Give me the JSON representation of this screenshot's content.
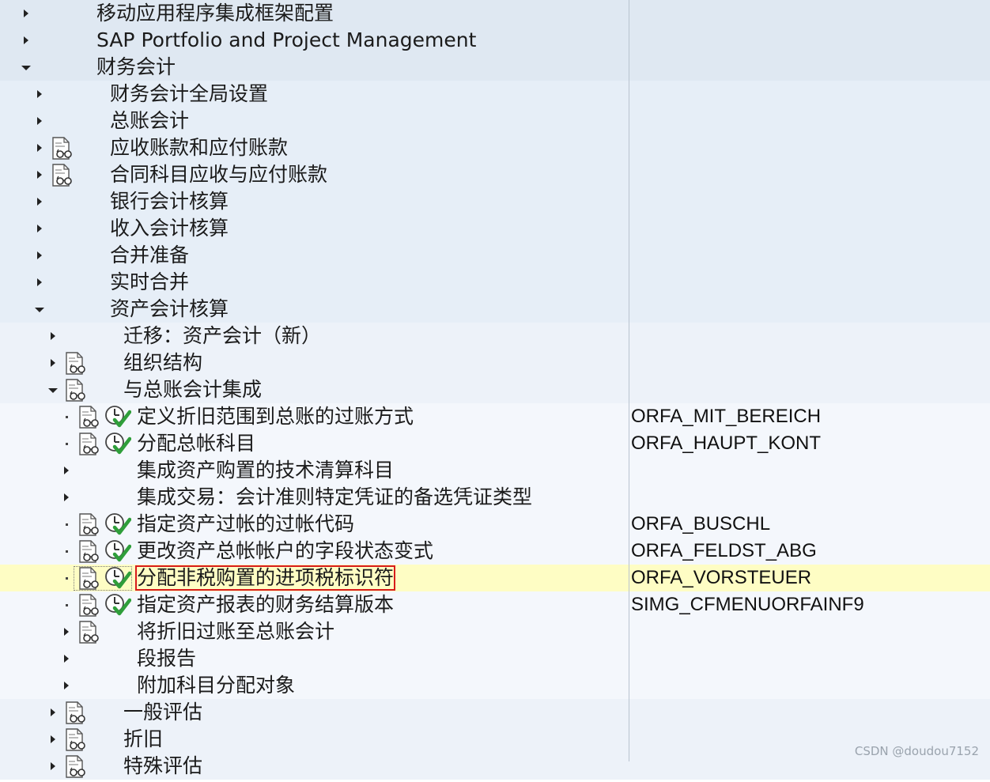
{
  "watermark": "CSDN @doudou7152",
  "colors": {
    "level0_bg": "#dfe8f2",
    "level1_bg": "#e6eef7",
    "level2_bg": "#edf2f9",
    "level3_bg": "#f4f7fc",
    "selected_bg": "#fefdc4",
    "focus_outline": "#d81b1b",
    "check_green": "#2f9e3a"
  },
  "tree": {
    "nodes": [
      {
        "label": "移动应用程序集成框架配置",
        "level": 0,
        "expander": "collapsed",
        "doc_icon": false,
        "activity_icon": false,
        "tech_name": ""
      },
      {
        "label": "SAP Portfolio and Project Management",
        "level": 0,
        "expander": "collapsed",
        "doc_icon": false,
        "activity_icon": false,
        "tech_name": ""
      },
      {
        "label": "财务会计",
        "level": 0,
        "expander": "expanded",
        "doc_icon": false,
        "activity_icon": false,
        "tech_name": ""
      },
      {
        "label": "财务会计全局设置",
        "level": 1,
        "expander": "collapsed",
        "doc_icon": false,
        "activity_icon": false,
        "tech_name": ""
      },
      {
        "label": "总账会计",
        "level": 1,
        "expander": "collapsed",
        "doc_icon": false,
        "activity_icon": false,
        "tech_name": ""
      },
      {
        "label": "应收账款和应付账款",
        "level": 1,
        "expander": "collapsed",
        "doc_icon": true,
        "activity_icon": false,
        "tech_name": ""
      },
      {
        "label": "合同科目应收与应付账款",
        "level": 1,
        "expander": "collapsed",
        "doc_icon": true,
        "activity_icon": false,
        "tech_name": ""
      },
      {
        "label": "银行会计核算",
        "level": 1,
        "expander": "collapsed",
        "doc_icon": false,
        "activity_icon": false,
        "tech_name": ""
      },
      {
        "label": "收入会计核算",
        "level": 1,
        "expander": "collapsed",
        "doc_icon": false,
        "activity_icon": false,
        "tech_name": ""
      },
      {
        "label": "合并准备",
        "level": 1,
        "expander": "collapsed",
        "doc_icon": false,
        "activity_icon": false,
        "tech_name": ""
      },
      {
        "label": "实时合并",
        "level": 1,
        "expander": "collapsed",
        "doc_icon": false,
        "activity_icon": false,
        "tech_name": ""
      },
      {
        "label": "资产会计核算",
        "level": 1,
        "expander": "expanded",
        "doc_icon": false,
        "activity_icon": false,
        "tech_name": ""
      },
      {
        "label": "迁移：资产会计（新）",
        "level": 2,
        "expander": "collapsed",
        "doc_icon": false,
        "activity_icon": false,
        "tech_name": ""
      },
      {
        "label": "组织结构",
        "level": 2,
        "expander": "collapsed",
        "doc_icon": true,
        "activity_icon": false,
        "tech_name": ""
      },
      {
        "label": "与总账会计集成",
        "level": 2,
        "expander": "expanded",
        "doc_icon": true,
        "activity_icon": false,
        "tech_name": ""
      },
      {
        "label": "定义折旧范围到总账的过账方式",
        "level": 3,
        "expander": "leaf",
        "doc_icon": true,
        "activity_icon": true,
        "tech_name": "ORFA_MIT_BEREICH"
      },
      {
        "label": "分配总帐科目",
        "level": 3,
        "expander": "leaf",
        "doc_icon": true,
        "activity_icon": true,
        "tech_name": "ORFA_HAUPT_KONT"
      },
      {
        "label": "集成资产购置的技术清算科目",
        "level": 3,
        "expander": "collapsed",
        "doc_icon": false,
        "activity_icon": false,
        "tech_name": ""
      },
      {
        "label": "集成交易：会计准则特定凭证的备选凭证类型",
        "level": 3,
        "expander": "collapsed",
        "doc_icon": false,
        "activity_icon": false,
        "tech_name": ""
      },
      {
        "label": "指定资产过帐的过帐代码",
        "level": 3,
        "expander": "leaf",
        "doc_icon": true,
        "activity_icon": true,
        "tech_name": "ORFA_BUSCHL"
      },
      {
        "label": "更改资产总帐帐户的字段状态变式",
        "level": 3,
        "expander": "leaf",
        "doc_icon": true,
        "activity_icon": true,
        "tech_name": "ORFA_FELDST_ABG"
      },
      {
        "label": "分配非税购置的进项税标识符",
        "level": 3,
        "expander": "leaf",
        "doc_icon": true,
        "activity_icon": true,
        "tech_name": "ORFA_VORSTEUER",
        "selected": true
      },
      {
        "label": "指定资产报表的财务结算版本",
        "level": 3,
        "expander": "leaf",
        "doc_icon": true,
        "activity_icon": true,
        "tech_name": "SIMG_CFMENUORFAINF9"
      },
      {
        "label": "将折旧过账至总账会计",
        "level": 3,
        "expander": "collapsed",
        "doc_icon": true,
        "activity_icon": false,
        "tech_name": ""
      },
      {
        "label": "段报告",
        "level": 3,
        "expander": "collapsed",
        "doc_icon": false,
        "activity_icon": false,
        "tech_name": ""
      },
      {
        "label": "附加科目分配对象",
        "level": 3,
        "expander": "collapsed",
        "doc_icon": false,
        "activity_icon": false,
        "tech_name": ""
      },
      {
        "label": "一般评估",
        "level": 2,
        "expander": "collapsed",
        "doc_icon": true,
        "activity_icon": false,
        "tech_name": ""
      },
      {
        "label": "折旧",
        "level": 2,
        "expander": "collapsed",
        "doc_icon": true,
        "activity_icon": false,
        "tech_name": ""
      },
      {
        "label": "特殊评估",
        "level": 2,
        "expander": "collapsed",
        "doc_icon": true,
        "activity_icon": false,
        "tech_name": ""
      }
    ]
  }
}
